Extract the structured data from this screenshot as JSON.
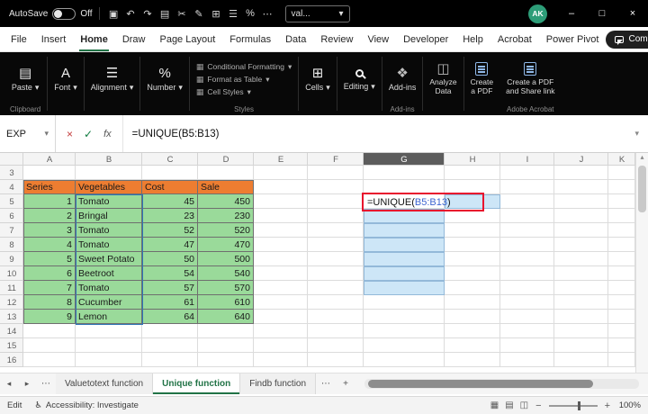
{
  "theme": {
    "accent": "#217346",
    "green": "#21a366",
    "avatar": "#2d9d78",
    "orange": "#ED7D31",
    "data_fill": "#9ADA9A",
    "spill_fill": "#CDE6F7",
    "ref_blue": "#2E75B6",
    "red": "#e8112d",
    "formula_range_color": "#3c64d0"
  },
  "titlebar": {
    "autosave_label": "AutoSave",
    "autosave_state": "Off",
    "quick_icons": [
      {
        "name": "save-icon",
        "glyph": "▣"
      },
      {
        "name": "undo-icon",
        "glyph": "↶"
      },
      {
        "name": "redo-icon",
        "glyph": "↷"
      },
      {
        "name": "copy-icon",
        "glyph": "▤"
      },
      {
        "name": "cut-icon",
        "glyph": "✂"
      },
      {
        "name": "format-painter-icon",
        "glyph": "✎"
      },
      {
        "name": "table-icon",
        "glyph": "⊞"
      },
      {
        "name": "menu-icon",
        "glyph": "☰"
      },
      {
        "name": "percent-icon",
        "glyph": "%"
      },
      {
        "name": "more-icon",
        "glyph": "⋯"
      }
    ],
    "search_value": "val...",
    "avatar": "AK",
    "window": {
      "min": "–",
      "max": "□",
      "close": "×"
    }
  },
  "menubar": {
    "items": [
      "File",
      "Insert",
      "Home",
      "Draw",
      "Page Layout",
      "Formulas",
      "Data",
      "Review",
      "View",
      "Developer",
      "Help",
      "Acrobat",
      "Power Pivot"
    ],
    "active": "Home",
    "comments_label": "Comments"
  },
  "ribbon": {
    "paste": "Paste",
    "clipboard_group": "Clipboard",
    "font": "Font",
    "font_icon": "A",
    "alignment": "Alignment",
    "align_icon": "☰",
    "number": "Number",
    "number_icon": "%",
    "conditional_formatting": "Conditional Formatting",
    "format_as_table": "Format as Table",
    "cell_styles": "Cell Styles",
    "styles_icon": "▦",
    "styles_group": "Styles",
    "cells": "Cells",
    "cells_icon": "⊞",
    "editing": "Editing",
    "addins": "Add-ins",
    "addins_icon": "❖",
    "analyze_line1": "Analyze",
    "analyze_line2": "Data",
    "analyze_icon": "◫",
    "pdf_line1": "Create",
    "pdf_line2": "a PDF",
    "pdf_share_line1": "Create a PDF",
    "pdf_share_line2": "and Share link",
    "acrobat_group": "Adobe Acrobat",
    "addins_group": "Add-ins",
    "paste_icon": "▤"
  },
  "formula_bar": {
    "name_box": "EXP",
    "cancel": "×",
    "enter": "✓",
    "fx": "fx",
    "formula": "=UNIQUE(B5:B13)"
  },
  "grid": {
    "columns": [
      "A",
      "B",
      "C",
      "D",
      "E",
      "F",
      "G",
      "H",
      "I",
      "J",
      "K"
    ],
    "row_start": 3,
    "row_end": 16,
    "selected_column": "G",
    "table": {
      "header_row": 4,
      "headers": [
        "Series",
        "Vegetables",
        "Cost",
        "Sale"
      ],
      "rows": [
        [
          1,
          "Tomato",
          45,
          450
        ],
        [
          2,
          "Bringal",
          23,
          230
        ],
        [
          3,
          "Tomato",
          52,
          520
        ],
        [
          4,
          "Tomato",
          47,
          470
        ],
        [
          5,
          "Sweet Potato",
          50,
          500
        ],
        [
          6,
          "Beetroot",
          54,
          540
        ],
        [
          7,
          "Tomato",
          57,
          570
        ],
        [
          8,
          "Cucumber",
          61,
          610
        ],
        [
          9,
          "Lemon",
          64,
          640
        ]
      ]
    },
    "formula_cell": {
      "ref": "G5",
      "prefix": "=UNIQUE(",
      "range": "B5:B13",
      "suffix": ")"
    },
    "spill": {
      "col": "G",
      "first_row": 6,
      "last_row": 11
    },
    "extra_spill_cell": {
      "col": "H",
      "row": 5
    }
  },
  "sheet_tabs": {
    "prev": "◂",
    "next": "▸",
    "more": "⋯",
    "tabs": [
      "Valuetotext function",
      "Unique function",
      "Findb function"
    ],
    "active": "Unique function",
    "add": "+"
  },
  "status_bar": {
    "mode": "Edit",
    "accessibility_icon": "♿",
    "accessibility": "Accessibility: Investigate",
    "zoom": "100%",
    "minus": "−",
    "plus": "+",
    "view_icons": [
      {
        "name": "view-normal-icon",
        "glyph": "▦"
      },
      {
        "name": "view-page-layout-icon",
        "glyph": "▤"
      },
      {
        "name": "view-page-break-icon",
        "glyph": "◫"
      }
    ]
  },
  "icons": {
    "caret": "▾",
    "up_arrow": "▴",
    "share_arrow": "↗"
  }
}
